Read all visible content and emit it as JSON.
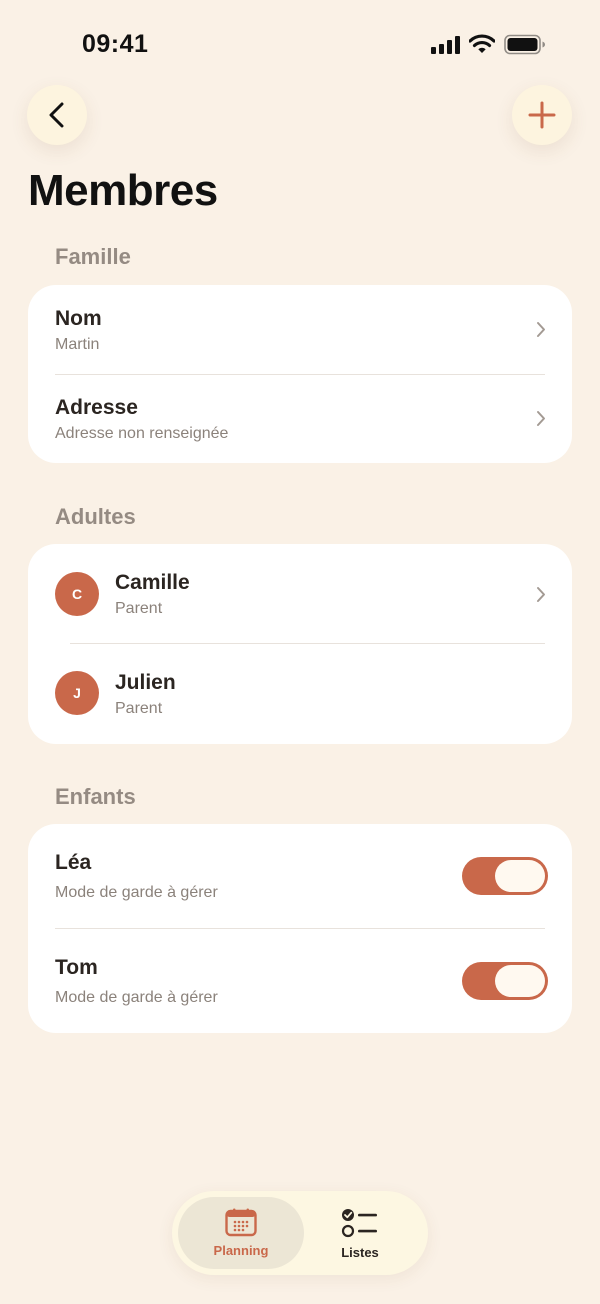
{
  "status_bar": {
    "time": "09:41"
  },
  "header": {
    "title": "Membres"
  },
  "famille": {
    "label": "Famille",
    "rows": [
      {
        "title": "Nom",
        "subtitle": "Martin"
      },
      {
        "title": "Adresse",
        "subtitle": "Adresse non renseignée"
      }
    ]
  },
  "adultes": {
    "label": "Adultes",
    "rows": [
      {
        "initial": "C",
        "title": "Camille",
        "subtitle": "Parent"
      },
      {
        "initial": "J",
        "title": "Julien",
        "subtitle": "Parent"
      }
    ]
  },
  "enfants": {
    "label": "Enfants",
    "rows": [
      {
        "title": "Léa",
        "subtitle": "Mode de garde à gérer",
        "toggle_on": true
      },
      {
        "title": "Tom",
        "subtitle": "Mode de garde à gérer",
        "toggle_on": true
      }
    ]
  },
  "tabs": [
    {
      "label": "Planning",
      "icon": "calendar-icon",
      "active": true
    },
    {
      "label": "Listes",
      "icon": "checklist-icon",
      "active": false
    }
  ],
  "colors": {
    "background": "#faf1e6",
    "accent": "#c9684a",
    "card": "#ffffff",
    "section_label": "#958b83"
  }
}
